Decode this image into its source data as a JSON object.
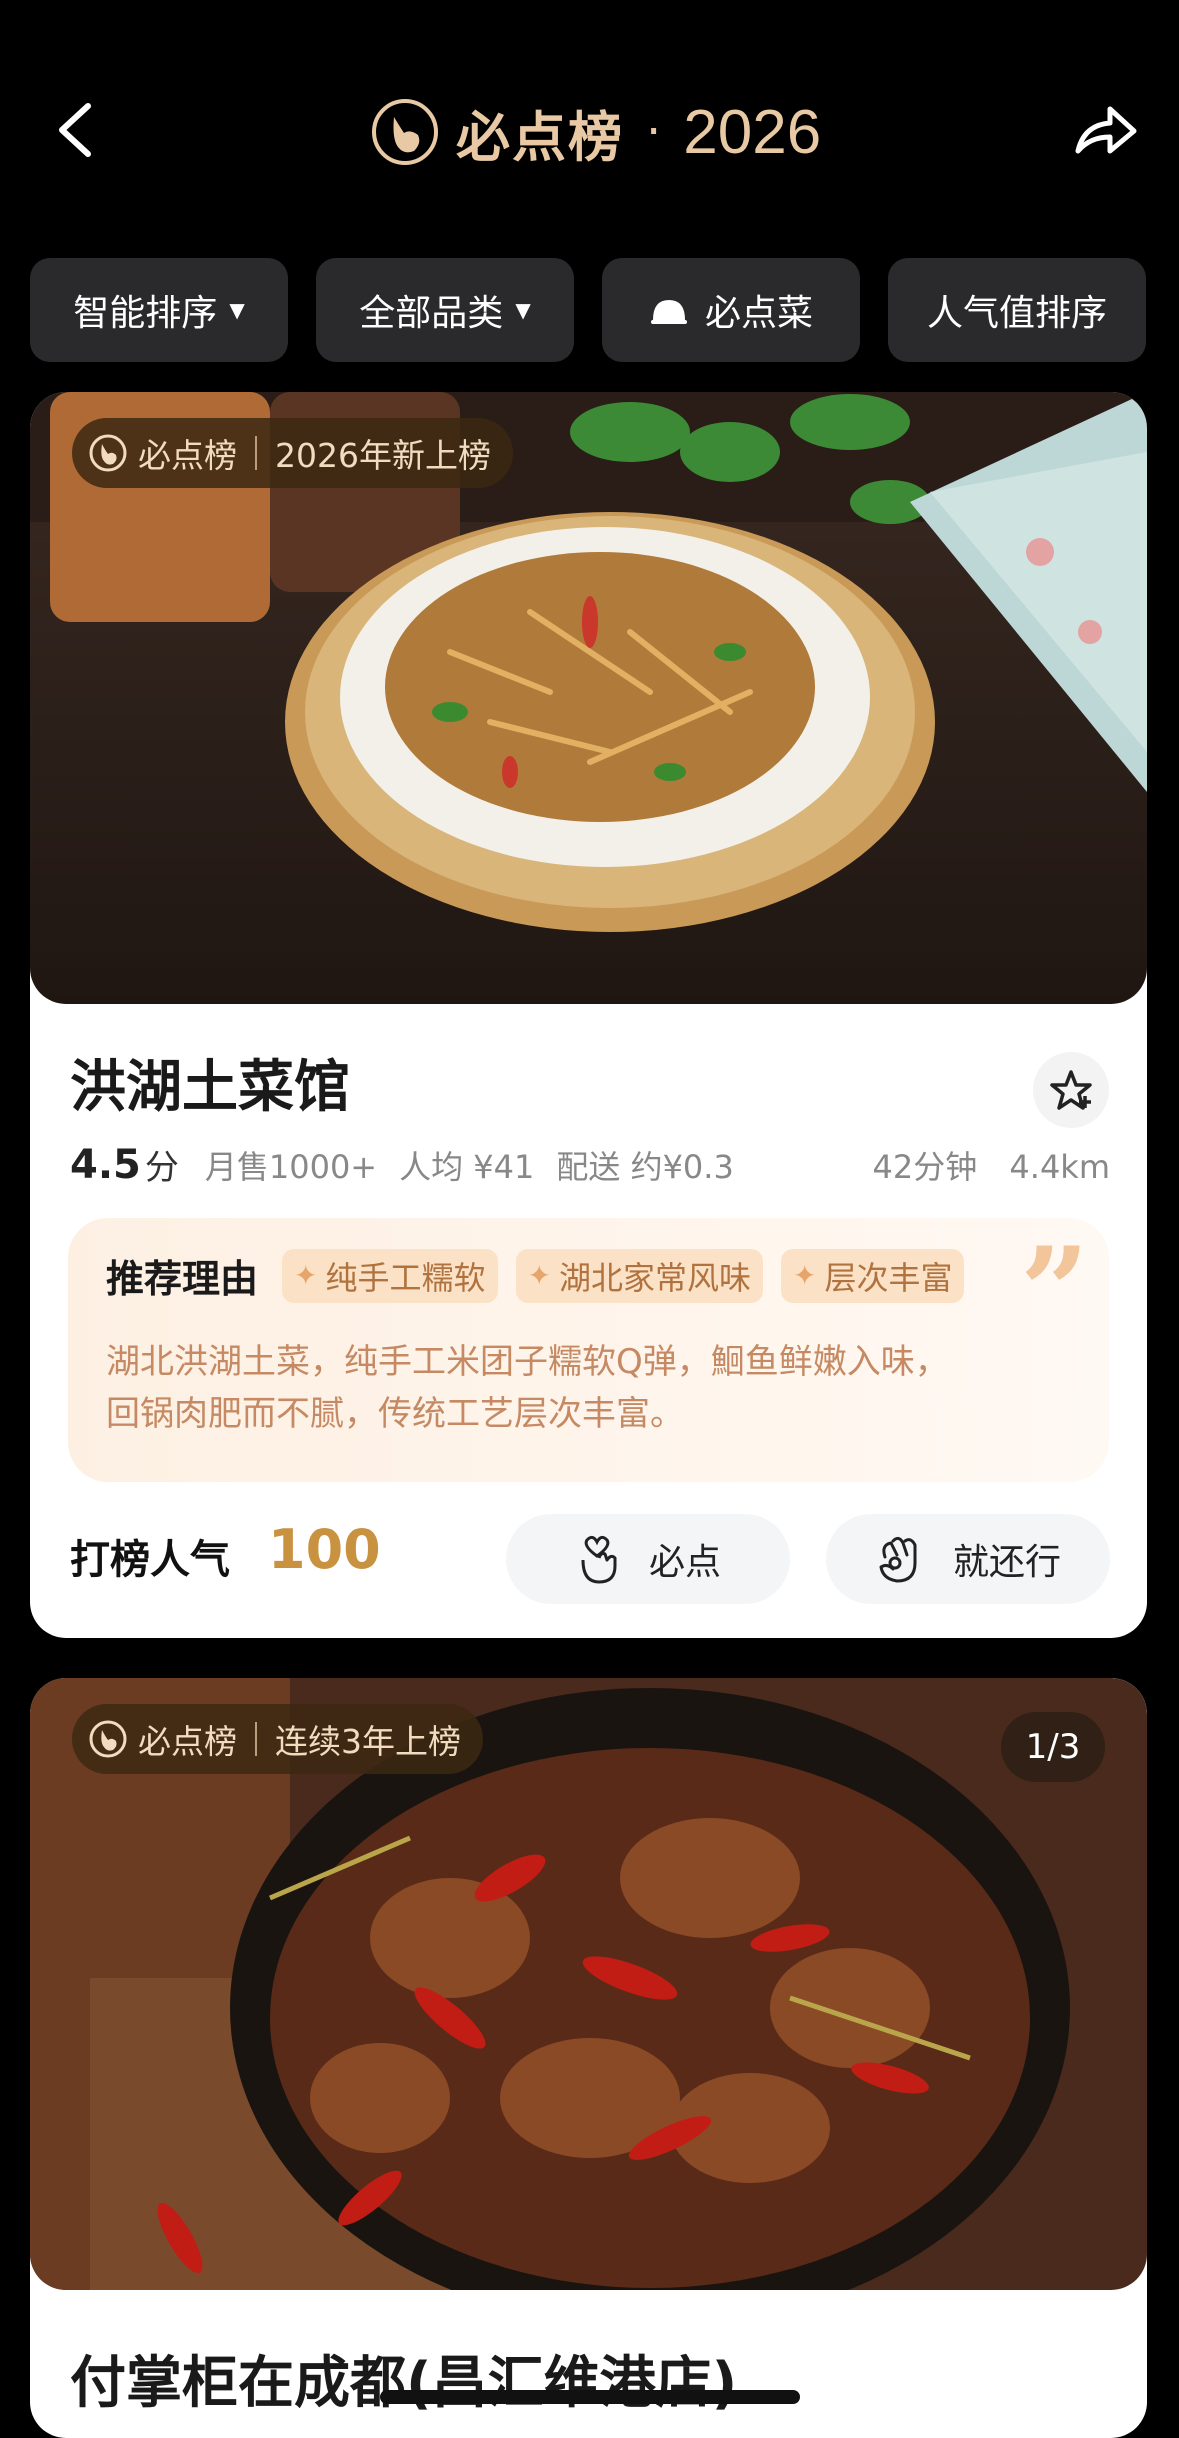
{
  "header": {
    "brand": "必点榜",
    "dot": "·",
    "year": "2026"
  },
  "filters": [
    {
      "label": "智能排序",
      "caret": "▼"
    },
    {
      "label": "全部品类",
      "caret": "▼"
    },
    {
      "label": "必点菜"
    },
    {
      "label": "人气值排序"
    }
  ],
  "cards": [
    {
      "badge_brand": "必点榜",
      "badge_text": "2026年新上榜",
      "name": "洪湖土菜馆",
      "score": "4.5",
      "score_unit": "分",
      "monthly_sales": "月售1000+",
      "avg_price": "人均 ¥41",
      "delivery_fee": "配送 约¥0.3",
      "delivery_time": "42分钟",
      "distance": "4.4km",
      "reason_title": "推荐理由",
      "tags": [
        "纯手工糯软",
        "湖北家常风味",
        "层次丰富"
      ],
      "reason_lines": [
        "湖北洪湖土菜，纯手工米团子糯软Q弹，鮰鱼鲜嫩入味，",
        "回锅肉肥而不腻，传统工艺层次丰富。"
      ],
      "rank_label": "打榜人气",
      "rank_value": "100",
      "btn_must": "必点",
      "btn_ok": "就还行"
    },
    {
      "badge_brand": "必点榜",
      "badge_text": "连续3年上榜",
      "pager": "1/3",
      "name": "付掌柜在成都(昌汇维港店)"
    }
  ],
  "colors": {
    "background": "#000000",
    "brand_gold": "#e8c9a4",
    "rank_gold": "#c99240",
    "tag_bg": "#fbe2c6",
    "tag_text": "#b0733f"
  },
  "icons": {
    "back": "chevron-left-icon",
    "share": "share-arrow-icon",
    "brand": "thumb-logo-icon",
    "filter_dish": "cloche-icon",
    "favorite": "star-outline-icon",
    "must": "hand-heart-icon",
    "ok": "hand-ok-icon"
  }
}
